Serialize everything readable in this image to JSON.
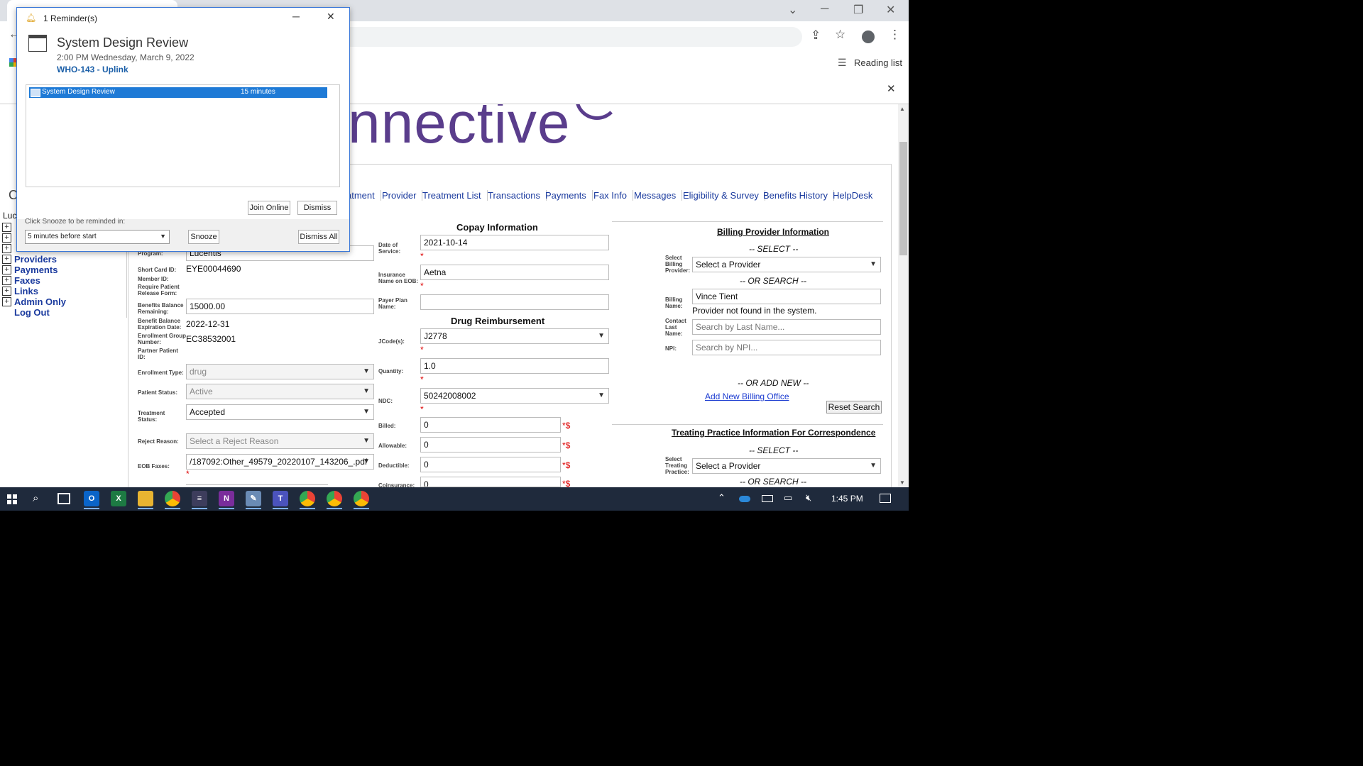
{
  "browser": {
    "reading_list": "Reading list"
  },
  "page": {
    "logo_text": "nnective",
    "nav_tabs": [
      "atment",
      "Provider",
      "Treatment List",
      "Transactions",
      "Payments",
      "Fax Info",
      "Messages",
      "Eligibility & Survey",
      "Benefits History",
      "HelpDesk"
    ],
    "sidebar": {
      "partial_label": "Luc",
      "items": [
        "Providers",
        "Payments",
        "Faxes",
        "Links",
        "Admin Only"
      ],
      "logout": "Log Out"
    },
    "left_form": {
      "program_label": "Program:",
      "program_value": "Lucentis",
      "short_card_label": "Short Card ID:",
      "short_card_value": "EYE00044690",
      "member_id_label": "Member ID:",
      "require_release_label": "Require Patient Release Form:",
      "benefits_balance_label": "Benefits Balance Remaining:",
      "benefits_balance_value": "15000.00",
      "benefit_exp_label": "Benefit Balance Expiration Date:",
      "benefit_exp_value": "2022-12-31",
      "enrollment_group_label": "Enrollment Group Number:",
      "enrollment_group_value": "EC38532001",
      "partner_patient_label": "Partner Patient ID:",
      "enrollment_type_label": "Enrollment Type:",
      "enrollment_type_value": "drug",
      "patient_status_label": "Patient Status:",
      "patient_status_value": "Active",
      "treatment_status_label": "Treatment Status:",
      "treatment_status_value": "Accepted",
      "reject_reason_label": "Reject Reason:",
      "reject_reason_value": "Select a Reject Reason",
      "eob_faxes_label": "EOB Faxes:",
      "eob_faxes_value": "/187092:Other_49579_20220107_143206_.pdf"
    },
    "copay": {
      "title": "Copay Information",
      "date_of_service_label": "Date of Service:",
      "date_of_service_value": "2021-10-14",
      "insurance_name_label": "Insurance Name on EOB:",
      "insurance_name_value": "Aetna",
      "payer_plan_label": "Payer Plan Name:",
      "payer_plan_value": ""
    },
    "drug": {
      "title": "Drug Reimbursement",
      "jcode_label": "JCode(s):",
      "jcode_value": "J2778",
      "quantity_label": "Quantity:",
      "quantity_value": "1.0",
      "ndc_label": "NDC:",
      "ndc_value": "50242008002",
      "billed_label": "Billed:",
      "billed_value": "0",
      "allowable_label": "Allowable:",
      "allowable_value": "0",
      "deductible_label": "Deductible:",
      "deductible_value": "0",
      "coinsurance_label": "Coinsurance:",
      "coinsurance_value": "0",
      "currency_mark": "*$"
    },
    "billing": {
      "title": "Billing Provider Information",
      "select_heading": "-- SELECT --",
      "select_label": "Select Billing Provider:",
      "select_value": "Select a Provider",
      "or_search": "-- OR SEARCH --",
      "billing_name_label": "Billing Name:",
      "billing_name_value": "Vince Tient",
      "not_found": "Provider not found in the system.",
      "contact_last_label": "Contact Last Name:",
      "contact_last_placeholder": "Search by Last Name...",
      "npi_label": "NPI:",
      "npi_placeholder": "Search by NPI...",
      "or_add_new": "-- OR ADD NEW --",
      "add_new_link": "Add New Billing Office",
      "reset_button": "Reset Search"
    },
    "treating": {
      "title": "Treating Practice Information For Correspondence",
      "select_heading": "-- SELECT --",
      "select_label": "Select Treating Practice:",
      "select_value": "Select a Provider",
      "or_search": "-- OR SEARCH --"
    }
  },
  "reminder": {
    "window_title": "1 Reminder(s)",
    "event_title": "System Design Review",
    "event_time": "2:00 PM Wednesday, March 9, 2022",
    "event_location": "WHO-143 - Uplink",
    "list_item_name": "System Design Review",
    "list_item_due": "15 minutes",
    "join_button": "Join Online",
    "dismiss_button": "Dismiss",
    "snooze_prompt": "Click Snooze to be reminded in:",
    "snooze_value": "5 minutes before start",
    "snooze_button": "Snooze",
    "dismiss_all_button": "Dismiss All"
  },
  "taskbar": {
    "time": "1:45 PM"
  }
}
